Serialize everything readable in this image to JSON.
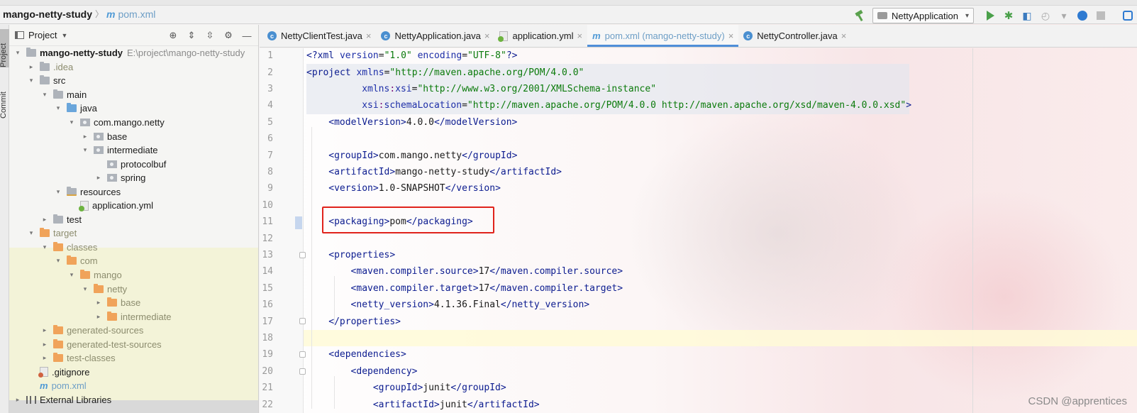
{
  "navbar": {
    "project": "mango-netty-study",
    "separator": "〉",
    "file_icon": "m",
    "file": "pom.xml",
    "run_config": "NettyApplication",
    "icons": [
      "hammer-icon",
      "run-icon",
      "debug-icon",
      "coverage-icon",
      "profile-icon",
      "stop-icon",
      "update-icon",
      "search-icon"
    ]
  },
  "stripe": {
    "tabs": [
      "Project",
      "Commit"
    ]
  },
  "project_panel": {
    "title": "Project",
    "tree": [
      {
        "label": "mango-netty-study",
        "extra": "E:\\project\\mango-netty-study",
        "depth": 0,
        "arrow": "▾",
        "icon": "f-grey",
        "bold": true
      },
      {
        "label": ".idea",
        "depth": 1,
        "arrow": "▸",
        "icon": "f-grey",
        "excluded": true
      },
      {
        "label": "src",
        "depth": 1,
        "arrow": "▾",
        "icon": "f-grey"
      },
      {
        "label": "main",
        "depth": 2,
        "arrow": "▾",
        "icon": "f-grey"
      },
      {
        "label": "java",
        "depth": 3,
        "arrow": "▾",
        "icon": "f-blue"
      },
      {
        "label": "com.mango.netty",
        "depth": 4,
        "arrow": "▾",
        "icon": "pkg"
      },
      {
        "label": "base",
        "depth": 5,
        "arrow": "▸",
        "icon": "pkg"
      },
      {
        "label": "intermediate",
        "depth": 5,
        "arrow": "▾",
        "icon": "pkg"
      },
      {
        "label": "protocolbuf",
        "depth": 6,
        "arrow": "",
        "icon": "pkg"
      },
      {
        "label": "spring",
        "depth": 6,
        "arrow": "▸",
        "icon": "pkg"
      },
      {
        "label": "resources",
        "depth": 3,
        "arrow": "▾",
        "icon": "f-res"
      },
      {
        "label": "application.yml",
        "depth": 4,
        "arrow": "",
        "icon": "yml"
      },
      {
        "label": "test",
        "depth": 2,
        "arrow": "▸",
        "icon": "f-grey"
      },
      {
        "label": "target",
        "depth": 1,
        "arrow": "▾",
        "icon": "f-orange",
        "excluded": true
      },
      {
        "label": "classes",
        "depth": 2,
        "arrow": "▾",
        "icon": "f-orange",
        "excluded": true
      },
      {
        "label": "com",
        "depth": 3,
        "arrow": "▾",
        "icon": "f-orange",
        "excluded": true
      },
      {
        "label": "mango",
        "depth": 4,
        "arrow": "▾",
        "icon": "f-orange",
        "excluded": true
      },
      {
        "label": "netty",
        "depth": 5,
        "arrow": "▾",
        "icon": "f-orange",
        "excluded": true
      },
      {
        "label": "base",
        "depth": 6,
        "arrow": "▸",
        "icon": "f-orange",
        "excluded": true
      },
      {
        "label": "intermediate",
        "depth": 6,
        "arrow": "▸",
        "icon": "f-orange",
        "excluded": true
      },
      {
        "label": "generated-sources",
        "depth": 2,
        "arrow": "▸",
        "icon": "f-orange",
        "excluded": true
      },
      {
        "label": "generated-test-sources",
        "depth": 2,
        "arrow": "▸",
        "icon": "f-orange",
        "excluded": true
      },
      {
        "label": "test-classes",
        "depth": 2,
        "arrow": "▸",
        "icon": "f-orange",
        "excluded": true
      },
      {
        "label": ".gitignore",
        "depth": 1,
        "arrow": "",
        "icon": "git"
      },
      {
        "label": "pom.xml",
        "depth": 1,
        "arrow": "",
        "icon": "m",
        "selected": true
      },
      {
        "label": "External Libraries",
        "depth": 0,
        "arrow": "▸",
        "icon": "lib"
      }
    ]
  },
  "tabs": [
    {
      "label": "NettyClientTest.java",
      "icon": "c",
      "active": false
    },
    {
      "label": "NettyApplication.java",
      "icon": "c",
      "active": false
    },
    {
      "label": "application.yml",
      "icon": "yml",
      "active": false
    },
    {
      "label": "pom.xml (mango-netty-study)",
      "icon": "m",
      "active": true
    },
    {
      "label": "NettyController.java",
      "icon": "c",
      "active": false
    }
  ],
  "editor": {
    "lines": [
      {
        "n": "1",
        "indent": 0,
        "tokens": [
          [
            "tg",
            "<?"
          ],
          [
            "tg",
            "xml "
          ],
          [
            "an",
            "version"
          ],
          [
            "",
            "="
          ],
          [
            "av",
            "\"1.0\""
          ],
          [
            "",
            " "
          ],
          [
            "an",
            "encoding"
          ],
          [
            "",
            "="
          ],
          [
            "av",
            "\"UTF-8\""
          ],
          [
            "tg",
            "?>"
          ]
        ]
      },
      {
        "n": "2",
        "indent": 0,
        "tokens": [
          [
            "tg",
            "<project "
          ],
          [
            "an",
            "xmlns"
          ],
          [
            "",
            "="
          ],
          [
            "av",
            "\"http://maven.apache.org/POM/4.0.0\""
          ]
        ],
        "hl": true
      },
      {
        "n": "3",
        "indent": 10,
        "tokens": [
          [
            "an",
            "xmlns"
          ],
          [
            "ns",
            ":"
          ],
          [
            "an",
            "xsi"
          ],
          [
            "",
            "="
          ],
          [
            "av",
            "\"http://www.w3.org/2001/XMLSchema-instance\""
          ]
        ],
        "hl": true
      },
      {
        "n": "4",
        "indent": 10,
        "tokens": [
          [
            "an",
            "xsi"
          ],
          [
            "ns",
            ":"
          ],
          [
            "an",
            "schemaLocation"
          ],
          [
            "",
            "="
          ],
          [
            "av",
            "\"http://maven.apache.org/POM/4.0.0 http://maven.apache.org/xsd/maven-4.0.0.xsd\""
          ],
          [
            "tg",
            ">"
          ]
        ],
        "hl": true
      },
      {
        "n": "5",
        "indent": 4,
        "tokens": [
          [
            "tg",
            "<modelVersion>"
          ],
          [
            "",
            "4.0.0"
          ],
          [
            "tg",
            "</modelVersion>"
          ]
        ]
      },
      {
        "n": "6",
        "indent": 0,
        "tokens": []
      },
      {
        "n": "7",
        "indent": 4,
        "tokens": [
          [
            "tg",
            "<groupId>"
          ],
          [
            "",
            "com.mango.netty"
          ],
          [
            "tg",
            "</groupId>"
          ]
        ]
      },
      {
        "n": "8",
        "indent": 4,
        "tokens": [
          [
            "tg",
            "<artifactId>"
          ],
          [
            "",
            "mango-netty-study"
          ],
          [
            "tg",
            "</artifactId>"
          ]
        ]
      },
      {
        "n": "9",
        "indent": 4,
        "tokens": [
          [
            "tg",
            "<version>"
          ],
          [
            "",
            "1.0-SNAPSHOT"
          ],
          [
            "tg",
            "</version>"
          ]
        ]
      },
      {
        "n": "10",
        "indent": 0,
        "tokens": []
      },
      {
        "n": "11",
        "indent": 4,
        "tokens": [
          [
            "tg",
            "<packaging>"
          ],
          [
            "",
            "pom"
          ],
          [
            "tg",
            "</packaging>"
          ]
        ]
      },
      {
        "n": "12",
        "indent": 0,
        "tokens": []
      },
      {
        "n": "13",
        "indent": 4,
        "tokens": [
          [
            "tg",
            "<properties>"
          ]
        ],
        "fold": true
      },
      {
        "n": "14",
        "indent": 8,
        "tokens": [
          [
            "tg",
            "<maven.compiler.source>"
          ],
          [
            "",
            "17"
          ],
          [
            "tg",
            "</maven.compiler.source>"
          ]
        ]
      },
      {
        "n": "15",
        "indent": 8,
        "tokens": [
          [
            "tg",
            "<maven.compiler.target>"
          ],
          [
            "",
            "17"
          ],
          [
            "tg",
            "</maven.compiler.target>"
          ]
        ]
      },
      {
        "n": "16",
        "indent": 8,
        "tokens": [
          [
            "tg",
            "<netty_version>"
          ],
          [
            "",
            "4.1.36.Final"
          ],
          [
            "tg",
            "</netty_version>"
          ]
        ]
      },
      {
        "n": "17",
        "indent": 4,
        "tokens": [
          [
            "tg",
            "</properties>"
          ]
        ],
        "fold": true
      },
      {
        "n": "18",
        "indent": 0,
        "tokens": [],
        "current": true
      },
      {
        "n": "19",
        "indent": 4,
        "tokens": [
          [
            "tg",
            "<dependencies>"
          ]
        ],
        "fold": true
      },
      {
        "n": "20",
        "indent": 8,
        "tokens": [
          [
            "tg",
            "<dependency>"
          ]
        ],
        "fold": true
      },
      {
        "n": "21",
        "indent": 12,
        "tokens": [
          [
            "tg",
            "<groupId>"
          ],
          [
            "",
            "junit"
          ],
          [
            "tg",
            "</groupId>"
          ]
        ]
      },
      {
        "n": "22",
        "indent": 12,
        "tokens": [
          [
            "tg",
            "<artifactId>"
          ],
          [
            "",
            "junit"
          ],
          [
            "tg",
            "</artifactId>"
          ]
        ]
      }
    ]
  },
  "watermark": "CSDN @apprentices"
}
